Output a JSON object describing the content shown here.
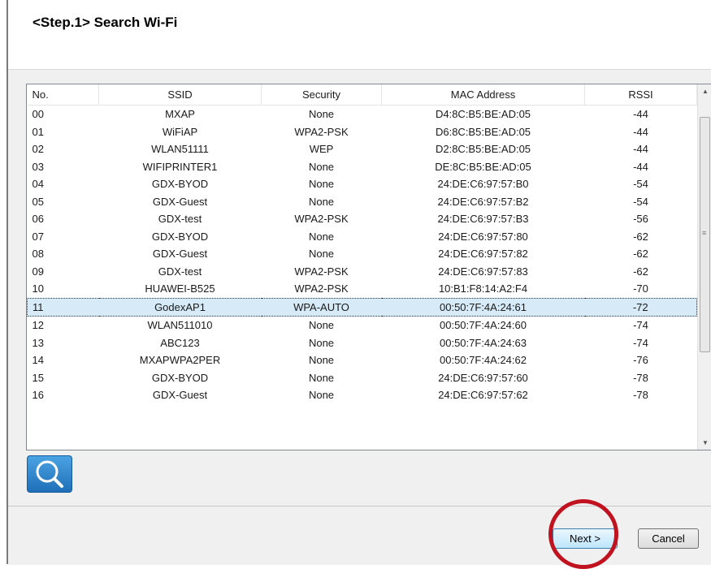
{
  "header": {
    "title": "<Step.1>  Search Wi-Fi"
  },
  "table": {
    "columns": [
      "No.",
      "SSID",
      "Security",
      "MAC Address",
      "RSSI"
    ],
    "selected_index": 11,
    "rows": [
      [
        "00",
        "MXAP",
        "None",
        "D4:8C:B5:BE:AD:05",
        "-44"
      ],
      [
        "01",
        "WiFiAP",
        "WPA2-PSK",
        "D6:8C:B5:BE:AD:05",
        "-44"
      ],
      [
        "02",
        "WLAN51111",
        "WEP",
        "D2:8C:B5:BE:AD:05",
        "-44"
      ],
      [
        "03",
        "WIFIPRINTER1",
        "None",
        "DE:8C:B5:BE:AD:05",
        "-44"
      ],
      [
        "04",
        "GDX-BYOD",
        "None",
        "24:DE:C6:97:57:B0",
        "-54"
      ],
      [
        "05",
        "GDX-Guest",
        "None",
        "24:DE:C6:97:57:B2",
        "-54"
      ],
      [
        "06",
        "GDX-test",
        "WPA2-PSK",
        "24:DE:C6:97:57:B3",
        "-56"
      ],
      [
        "07",
        "GDX-BYOD",
        "None",
        "24:DE:C6:97:57:80",
        "-62"
      ],
      [
        "08",
        "GDX-Guest",
        "None",
        "24:DE:C6:97:57:82",
        "-62"
      ],
      [
        "09",
        "GDX-test",
        "WPA2-PSK",
        "24:DE:C6:97:57:83",
        "-62"
      ],
      [
        "10",
        "HUAWEI-B525",
        "WPA2-PSK",
        "10:B1:F8:14:A2:F4",
        "-70"
      ],
      [
        "11",
        "GodexAP1",
        "WPA-AUTO",
        "00:50:7F:4A:24:61",
        "-72"
      ],
      [
        "12",
        "WLAN511010",
        "None",
        "00:50:7F:4A:24:60",
        "-74"
      ],
      [
        "13",
        "ABC123",
        "None",
        "00:50:7F:4A:24:63",
        "-74"
      ],
      [
        "14",
        "MXAPWPA2PER",
        "None",
        "00:50:7F:4A:24:62",
        "-76"
      ],
      [
        "15",
        "GDX-BYOD",
        "None",
        "24:DE:C6:97:57:60",
        "-78"
      ],
      [
        "16",
        "GDX-Guest",
        "None",
        "24:DE:C6:97:57:62",
        "-78"
      ]
    ]
  },
  "icons": {
    "search": "magnifier-icon"
  },
  "footer": {
    "next_label": "Next >",
    "cancel_label": "Cancel"
  },
  "colors": {
    "highlight_circle": "#c1121f",
    "selected_row": "#d6eaf8",
    "search_button": "#2a82cc"
  }
}
